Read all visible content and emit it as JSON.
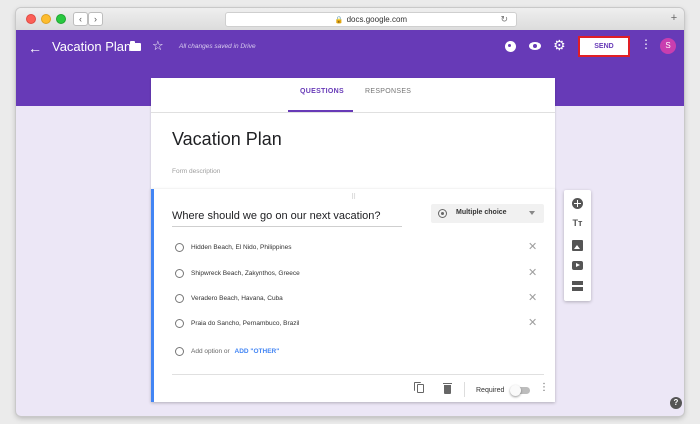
{
  "browser": {
    "url": "docs.google.com",
    "back_glyph": "‹",
    "forward_glyph": "›",
    "lock_glyph": "🔒",
    "reload_glyph": "↻",
    "new_tab_glyph": "+"
  },
  "header": {
    "back_glyph": "←",
    "title": "Vacation Plan",
    "star_glyph": "☆",
    "saved_status": "All changes saved in Drive",
    "gear_glyph": "⚙",
    "send_label": "SEND",
    "more_glyph": "⋮",
    "avatar_initial": "S",
    "colors": {
      "primary": "#673ab7",
      "avatar": "#c93eaf",
      "send_highlight": "#e01e26"
    }
  },
  "tabs": [
    {
      "label": "QUESTIONS",
      "active": true
    },
    {
      "label": "RESPONSES",
      "active": false
    }
  ],
  "form": {
    "title": "Vacation Plan",
    "description_placeholder": "Form description"
  },
  "question": {
    "drag_glyph": "⠿",
    "title": "Where should we go on our next vacation?",
    "type": "Multiple choice",
    "options": [
      "Hidden Beach, El Nido, Philippines",
      "Shipwreck Beach, Zakynthos, Greece",
      "Veradero Beach, Havana, Cuba",
      "Praia do Sancho, Pernambuco, Brazil"
    ],
    "remove_glyph": "✕",
    "add_option": "Add option",
    "add_or": "or",
    "add_other": "ADD \"OTHER\"",
    "required_label": "Required",
    "required": false,
    "more_glyph": "⋮"
  },
  "side_tools": {
    "title_glyph": "Tт"
  },
  "help_glyph": "?"
}
